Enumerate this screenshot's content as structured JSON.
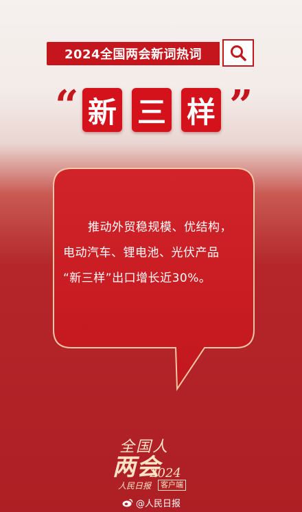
{
  "search_bar": {
    "text": "2024全国两会新词热词",
    "icon": "search-icon"
  },
  "headline": {
    "open_quote": "“",
    "chars": [
      "新",
      "三",
      "样"
    ],
    "close_quote": "”"
  },
  "body": {
    "lines": [
      "推动外贸稳规模、优结构，",
      "电动汽车、锂电池、光伏产品",
      "“新三样”出口增长近30%。"
    ]
  },
  "logo": {
    "top": "全国人",
    "big": "两会",
    "year": "2024",
    "brand": "人民日报",
    "client": "客户端"
  },
  "watermark": {
    "icon": "weibo-icon",
    "text": "@人民日报"
  },
  "colors": {
    "accent_red": "#c4161c",
    "bubble_red": "#cc1c22",
    "logo_gold": "#fbe3c6"
  }
}
